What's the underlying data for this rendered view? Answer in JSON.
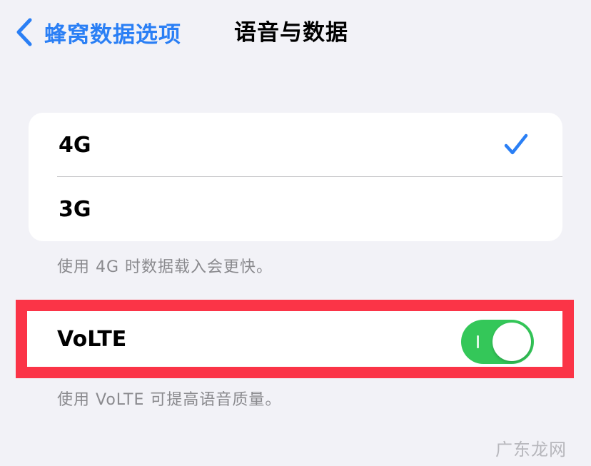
{
  "nav": {
    "back_label": "蜂窝数据选项",
    "title": "语音与数据"
  },
  "network_options": [
    {
      "label": "4G",
      "selected": true
    },
    {
      "label": "3G",
      "selected": false
    }
  ],
  "network_footnote": "使用 4G 时数据载入会更快。",
  "volte": {
    "label": "VoLTE",
    "enabled": true
  },
  "volte_footnote": "使用 VoLTE 可提高语音质量。",
  "watermark": "广东龙网",
  "colors": {
    "accent": "#2a7ff5",
    "toggle_on": "#34c759",
    "highlight_border": "#fb3447"
  }
}
